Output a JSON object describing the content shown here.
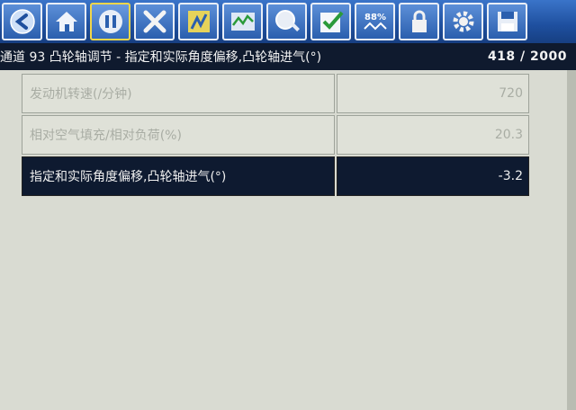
{
  "header": {
    "title": "通道 93 凸轮轴调节 - 指定和实际角度偏移,凸轮轴进气(°)",
    "counter": "418 / 2000"
  },
  "toolbar": {
    "zoom_label": "88%",
    "icons": [
      "back-icon",
      "home-icon",
      "pause-icon",
      "close-icon",
      "graph-list-icon",
      "waveform-icon",
      "zoom-icon",
      "check-icon",
      "zoom-percent-icon",
      "lock-icon",
      "gear-icon",
      "save-icon"
    ]
  },
  "rows": [
    {
      "label": "发动机转速(/分钟)",
      "value": "720"
    },
    {
      "label": "相对空气填充/相对负荷(%)",
      "value": "20.3"
    },
    {
      "label": "指定和实际角度偏移,凸轮轴进气(°)",
      "value": "-3.2"
    }
  ],
  "colors": {
    "toolbar": "#1e4f9e",
    "titlebar": "#0f1a2e",
    "selected_row": "#0e1a30",
    "active_border": "#f1d64a"
  }
}
